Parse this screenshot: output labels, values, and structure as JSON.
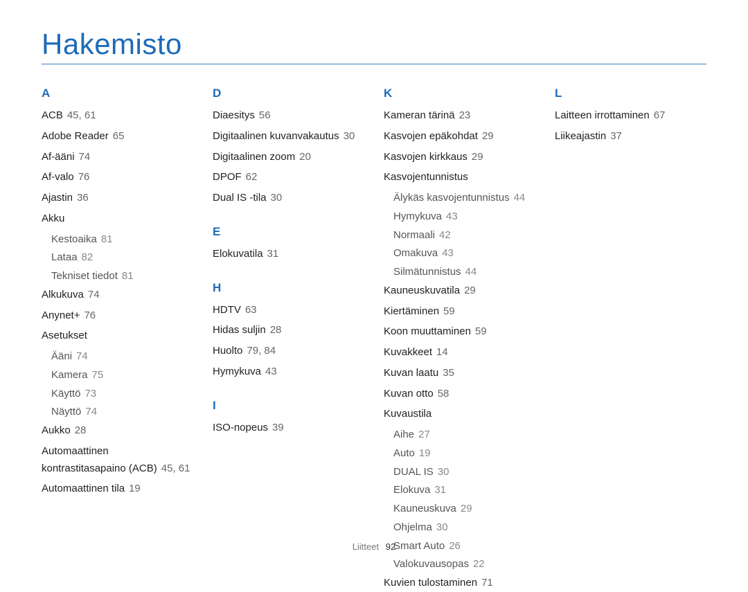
{
  "title": "Hakemisto",
  "footer": {
    "label": "Liitteet",
    "page": "92"
  },
  "sections": [
    {
      "letter": "A",
      "entries": [
        {
          "title": "ACB",
          "pages": "45, 61"
        },
        {
          "title": "Adobe Reader",
          "pages": "65"
        },
        {
          "title": "Af-ääni",
          "pages": "74"
        },
        {
          "title": "Af-valo",
          "pages": "76"
        },
        {
          "title": "Ajastin",
          "pages": "36"
        },
        {
          "title": "Akku",
          "pages": "",
          "sub": [
            {
              "title": "Kestoaika",
              "pages": "81"
            },
            {
              "title": "Lataa",
              "pages": "82"
            },
            {
              "title": "Tekniset tiedot",
              "pages": "81"
            }
          ]
        },
        {
          "title": "Alkukuva",
          "pages": "74"
        },
        {
          "title": "Anynet+",
          "pages": "76"
        },
        {
          "title": "Asetukset",
          "pages": "",
          "sub": [
            {
              "title": "Ääni",
              "pages": "74"
            },
            {
              "title": "Kamera",
              "pages": "75"
            },
            {
              "title": "Käyttö",
              "pages": "73"
            },
            {
              "title": "Näyttö",
              "pages": "74"
            }
          ]
        },
        {
          "title": "Aukko",
          "pages": "28"
        },
        {
          "title": "Automaattinen kontrastitasapaino (ACB)",
          "pages": "45, 61"
        },
        {
          "title": "Automaattinen tila",
          "pages": "19"
        }
      ]
    },
    {
      "letter": "D",
      "entries": [
        {
          "title": "Diaesitys",
          "pages": "56"
        },
        {
          "title": "Digitaalinen kuvanvakautus",
          "pages": "30"
        },
        {
          "title": "Digitaalinen zoom",
          "pages": "20"
        },
        {
          "title": "DPOF",
          "pages": "62"
        },
        {
          "title": "Dual IS -tila",
          "pages": "30"
        }
      ]
    },
    {
      "letter": "E",
      "entries": [
        {
          "title": "Elokuvatila",
          "pages": "31"
        }
      ]
    },
    {
      "letter": "H",
      "entries": [
        {
          "title": "HDTV",
          "pages": "63"
        },
        {
          "title": "Hidas suljin",
          "pages": "28"
        },
        {
          "title": "Huolto",
          "pages": "79, 84"
        },
        {
          "title": "Hymykuva",
          "pages": "43"
        }
      ]
    },
    {
      "letter": "I",
      "entries": [
        {
          "title": "ISO-nopeus",
          "pages": "39"
        }
      ]
    },
    {
      "letter": "K",
      "entries": [
        {
          "title": "Kameran tärinä",
          "pages": "23"
        },
        {
          "title": "Kasvojen epäkohdat",
          "pages": "29"
        },
        {
          "title": "Kasvojen kirkkaus",
          "pages": "29"
        },
        {
          "title": "Kasvojentunnistus",
          "pages": "",
          "sub": [
            {
              "title": "Älykäs kasvojentunnistus",
              "pages": "44"
            },
            {
              "title": "Hymykuva",
              "pages": "43"
            },
            {
              "title": "Normaali",
              "pages": "42"
            },
            {
              "title": "Omakuva",
              "pages": "43"
            },
            {
              "title": "Silmätunnistus",
              "pages": "44"
            }
          ]
        },
        {
          "title": "Kauneuskuvatila",
          "pages": "29"
        },
        {
          "title": "Kiertäminen",
          "pages": "59"
        },
        {
          "title": "Koon muuttaminen",
          "pages": "59"
        },
        {
          "title": "Kuvakkeet",
          "pages": "14"
        },
        {
          "title": "Kuvan laatu",
          "pages": "35"
        },
        {
          "title": "Kuvan otto",
          "pages": "58"
        },
        {
          "title": "Kuvaustila",
          "pages": "",
          "sub": [
            {
              "title": "Aihe",
              "pages": "27"
            },
            {
              "title": "Auto",
              "pages": "19"
            },
            {
              "title": "DUAL IS",
              "pages": "30"
            },
            {
              "title": "Elokuva",
              "pages": "31"
            },
            {
              "title": "Kauneuskuva",
              "pages": "29"
            },
            {
              "title": "Ohjelma",
              "pages": "30"
            },
            {
              "title": "Smart Auto",
              "pages": "26"
            },
            {
              "title": "Valokuvausopas",
              "pages": "22"
            }
          ]
        },
        {
          "title": "Kuvien tulostaminen",
          "pages": "71"
        }
      ]
    },
    {
      "letter": "L",
      "entries": [
        {
          "title": "Laitteen irrottaminen",
          "pages": "67"
        },
        {
          "title": "Liikeajastin",
          "pages": "37"
        }
      ]
    }
  ]
}
